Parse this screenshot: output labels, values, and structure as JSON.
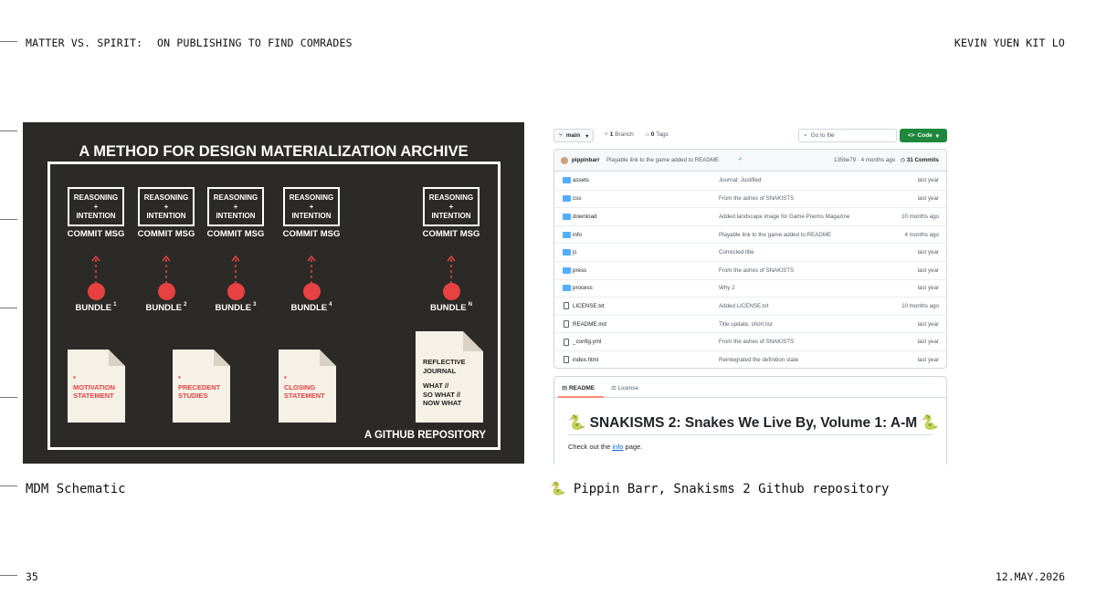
{
  "header": {
    "left_title": "MATTER VS. SPIRIT:",
    "subtitle": "ON PUBLISHING TO FIND COMRADES",
    "author": "KEVIN YUEN KIT LO"
  },
  "footer": {
    "page_number": "35",
    "date": "12.MAY.2026"
  },
  "captions": {
    "left": "MDM Schematic",
    "right": "🐍 Pippin Barr, Snakisms 2 Github repository"
  },
  "schematic": {
    "title": "A METHOD FOR DESIGN MATERIALIZATION ARCHIVE",
    "box_line1": "REASONING",
    "box_line2": "+",
    "box_line3": "INTENTION",
    "commit_label": "COMMIT MSG",
    "bundle_label": "BUNDLE",
    "bundles": [
      "1",
      "2",
      "3",
      "4",
      "N"
    ],
    "docs": {
      "motivation": [
        "MOTIVATION",
        "STATEMENT"
      ],
      "precedent": [
        "PRECEDENT",
        "STUDIES"
      ],
      "closing": [
        "CLOSING",
        "STATEMENT"
      ],
      "reflective": [
        "REFLECTIVE",
        "JOURNAL",
        "WHAT //",
        "SO WHAT //",
        "NOW WHAT"
      ]
    },
    "asterisk": "*",
    "footer_label": "A GITHUB REPOSITORY",
    "accent": "#e84142"
  },
  "github": {
    "branch": "main",
    "branches_count": "1",
    "branches_label": "Branch",
    "tags_count": "0",
    "tags_label": "Tags",
    "search_placeholder": "Go to file",
    "code_button": "Code",
    "last_commit": {
      "author": "pippinbarr",
      "message": "Playable link to the game added to README",
      "hash_time": "135be79 · 4 months ago",
      "commits_count": "31",
      "commits_label": "Commits"
    },
    "files": [
      {
        "name": "assets",
        "type": "folder",
        "msg": "Journal: Justified",
        "date": "last year"
      },
      {
        "name": "css",
        "type": "folder",
        "msg": "From the ashes of SNAKISTS",
        "date": "last year"
      },
      {
        "name": "download",
        "type": "folder",
        "msg": "Added landscape image for Game Poems Magazine",
        "date": "10 months ago"
      },
      {
        "name": "info",
        "type": "folder",
        "msg": "Playable link to the game added to README",
        "date": "4 months ago"
      },
      {
        "name": "js",
        "type": "folder",
        "msg": "Corrected title",
        "date": "last year"
      },
      {
        "name": "press",
        "type": "folder",
        "msg": "From the ashes of SNAKISTS",
        "date": "last year"
      },
      {
        "name": "process",
        "type": "folder",
        "msg": "Why 2",
        "date": "last year"
      },
      {
        "name": "LICENSE.txt",
        "type": "file",
        "msg": "Added LICENSE.txt",
        "date": "10 months ago"
      },
      {
        "name": "README.md",
        "type": "file",
        "msg": "Title update, short list",
        "date": "last year"
      },
      {
        "name": "_config.yml",
        "type": "file",
        "msg": "From the ashes of SNAKISTS",
        "date": "last year"
      },
      {
        "name": "index.html",
        "type": "file",
        "msg": "Reintegrated the definition state",
        "date": "last year"
      }
    ],
    "readme": {
      "tab_readme": "README",
      "tab_license": "License",
      "heading": "🐍 SNAKISMS 2: Snakes We Live By, Volume 1: A-M 🐍",
      "para_before": "Check out the ",
      "para_link": "info",
      "para_after": " page."
    },
    "colors": {
      "code_green": "#1f883d",
      "folder_blue": "#54aeff",
      "link_blue": "#0969da"
    }
  }
}
